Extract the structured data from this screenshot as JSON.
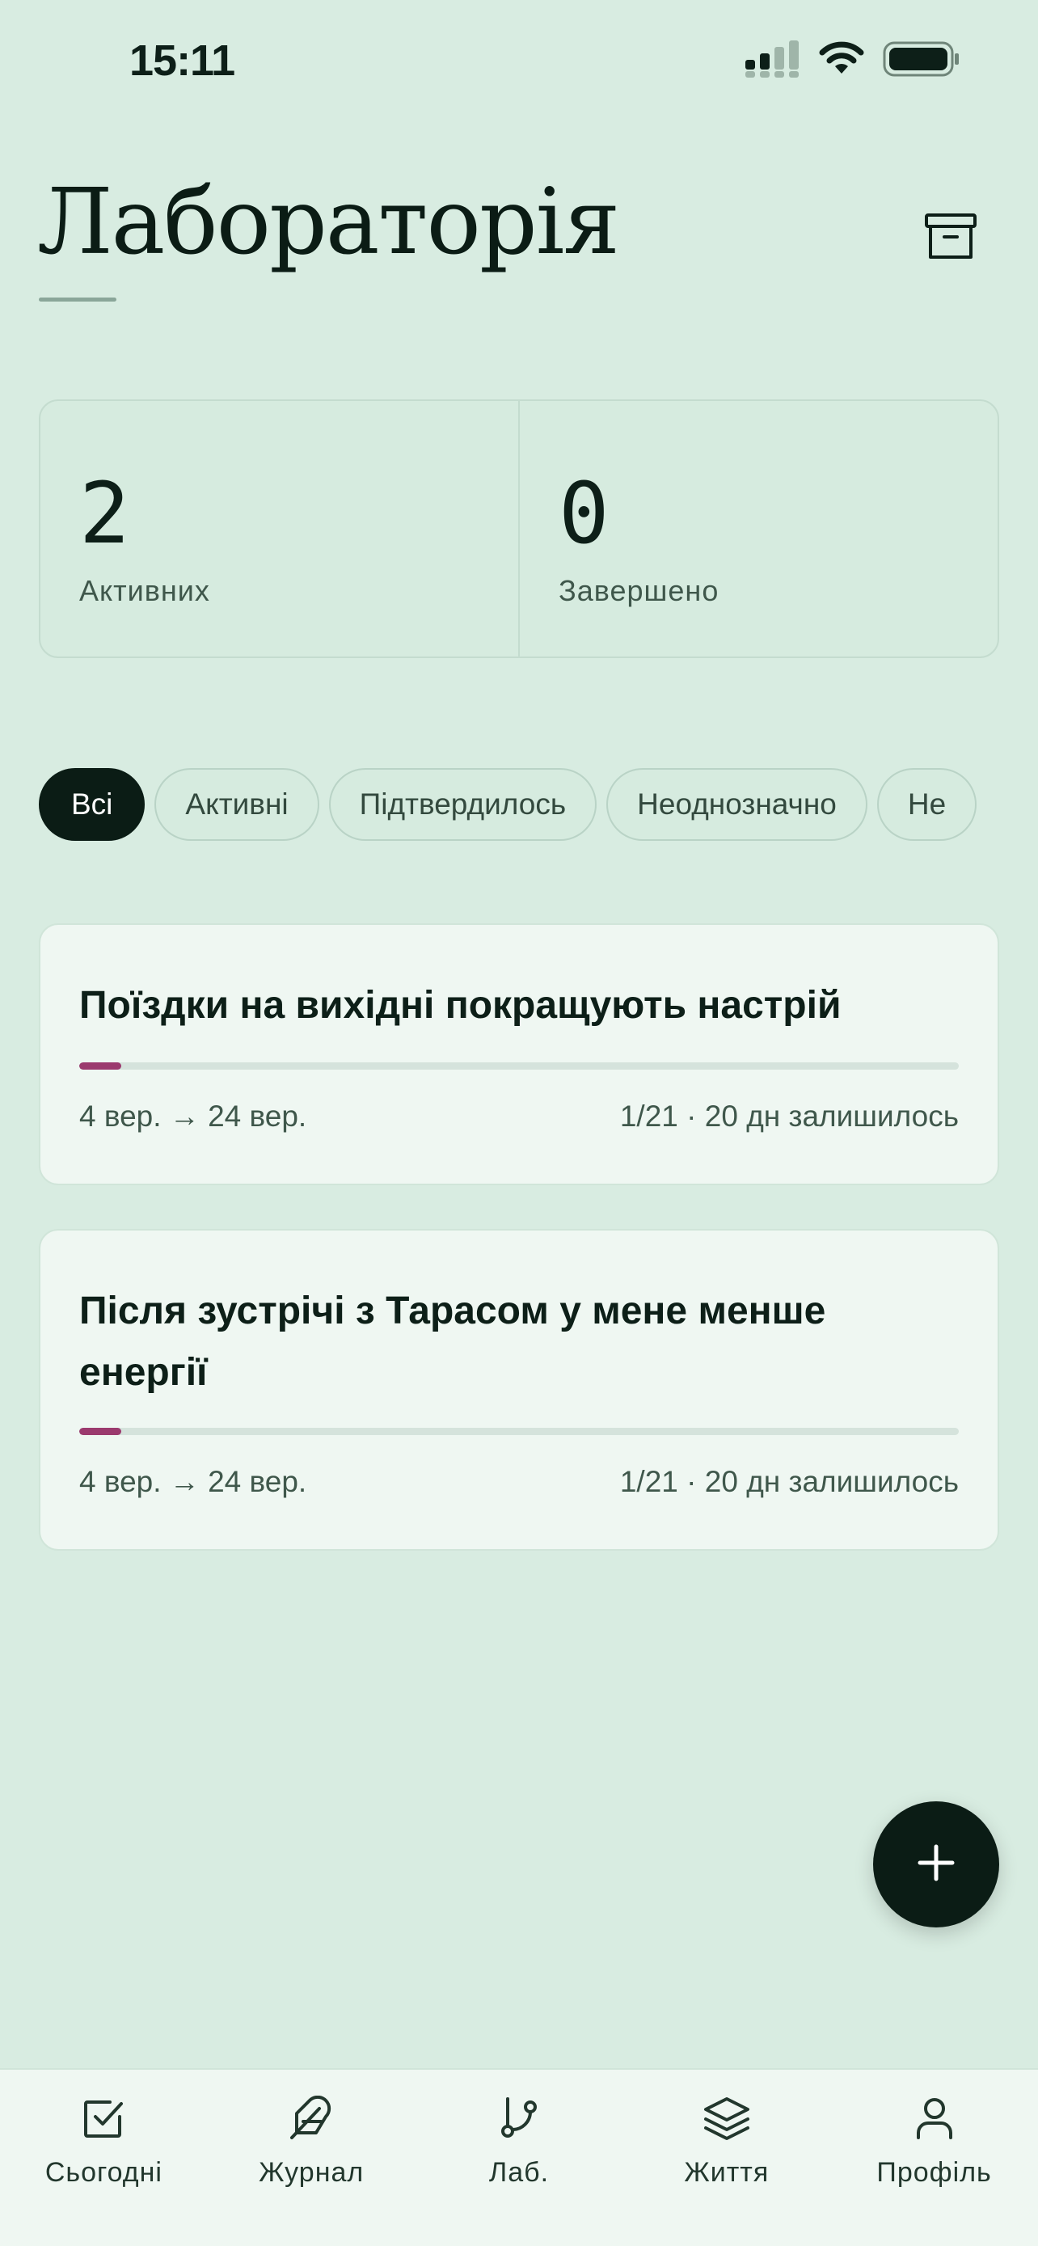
{
  "status_bar": {
    "time": "15:11",
    "icons": [
      "cellular-signal-icon",
      "wifi-icon",
      "battery-icon"
    ]
  },
  "header": {
    "title": "Лабораторія",
    "archive_icon": "archive-icon"
  },
  "stats": [
    {
      "value": "2",
      "label": "Активних"
    },
    {
      "value": "0",
      "label": "Завершено"
    }
  ],
  "filters": [
    {
      "label": "Всі",
      "active": true
    },
    {
      "label": "Активні",
      "active": false
    },
    {
      "label": "Підтвердилось",
      "active": false
    },
    {
      "label": "Неоднозначно",
      "active": false
    },
    {
      "label": "Не",
      "active": false
    }
  ],
  "experiments": [
    {
      "title": "Поїздки на вихідні покращують настрій",
      "dates": "4 вер. → 24 вер.",
      "remaining": "1/21 · 20 дн залишилось",
      "progress": 0.048
    },
    {
      "title": "Після зустрічі з Тарасом у мене менше енергії",
      "dates": "4 вер. → 24 вер.",
      "remaining": "1/21 · 20 дн залишилось",
      "progress": 0.048
    }
  ],
  "fab": {
    "icon": "plus-icon"
  },
  "bottom_nav": [
    {
      "label": "Сьогодні",
      "icon": "checkbox-icon"
    },
    {
      "label": "Журнал",
      "icon": "feather-icon"
    },
    {
      "label": "Лаб.",
      "icon": "git-branch-icon"
    },
    {
      "label": "Життя",
      "icon": "layers-icon"
    },
    {
      "label": "Профіль",
      "icon": "user-icon"
    }
  ],
  "colors": {
    "background": "#d8ece1",
    "card": "#eff7f2",
    "primary": "#0b1c15",
    "progress_accent": "#9b3a6e"
  }
}
